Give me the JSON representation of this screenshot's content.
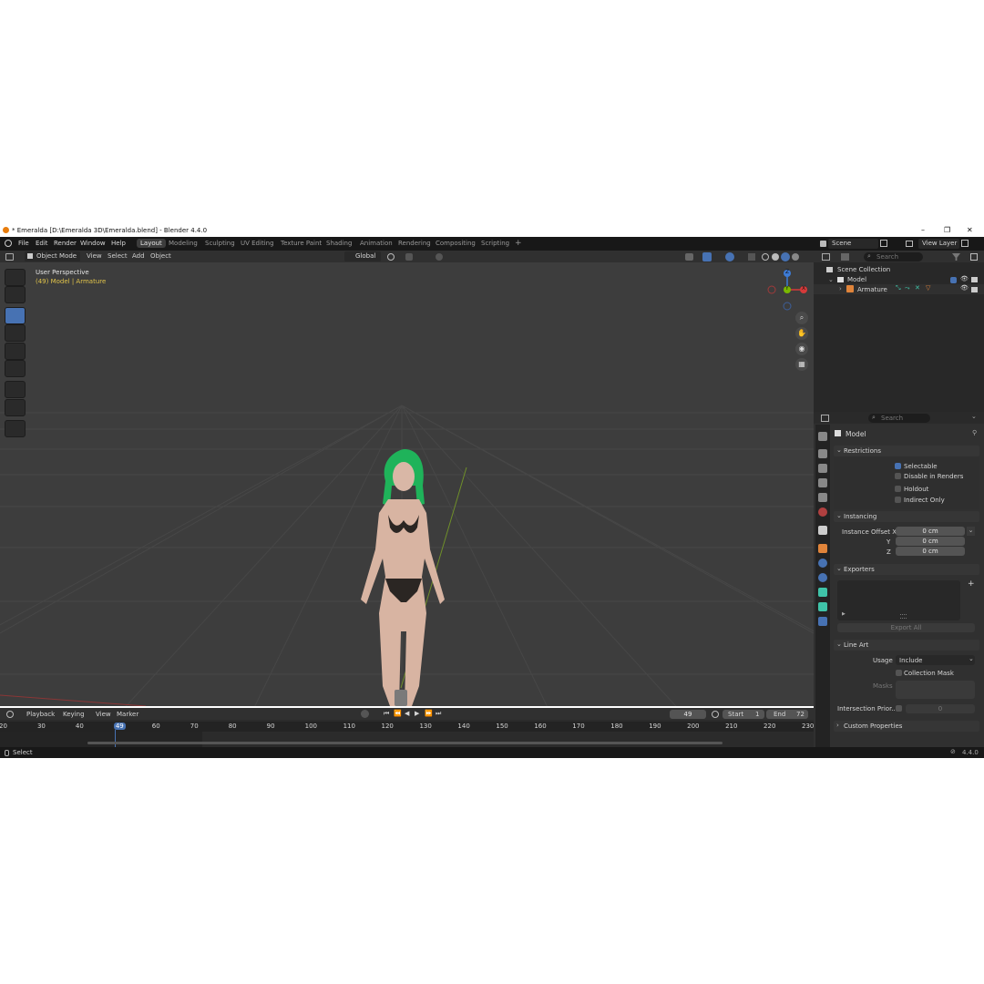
{
  "window": {
    "title": "* Emeralda [D:\\Emeralda 3D\\Emeralda.blend] - Blender 4.4.0",
    "minimize": "–",
    "maximize": "❐",
    "close": "✕"
  },
  "menu": [
    "File",
    "Edit",
    "Render",
    "Window",
    "Help"
  ],
  "workspaces": [
    "Layout",
    "Modeling",
    "Sculpting",
    "UV Editing",
    "Texture Paint",
    "Shading",
    "Animation",
    "Rendering",
    "Compositing",
    "Scripting"
  ],
  "workspace_add": "+",
  "topbar": {
    "scene_label": "Scene",
    "view_layer_label": "View Layer"
  },
  "viewport": {
    "mode": "Object Mode",
    "menus": [
      "View",
      "Select",
      "Add",
      "Object"
    ],
    "orientation": "Global",
    "perspective_label": "User Perspective",
    "context_label": "(49) Model | Armature",
    "gizmo": {
      "z": "Z",
      "y": "Y",
      "x": "X"
    }
  },
  "outliner": {
    "search_placeholder": "Search",
    "scene_collection": "Scene Collection",
    "collection": "Model",
    "child": "Armature"
  },
  "properties": {
    "search_placeholder": "Search",
    "object_name": "Model",
    "restrictions": {
      "title": "Restrictions",
      "selectable": "Selectable",
      "selectable_checked": true,
      "disable_in_renders": "Disable in Renders",
      "holdout": "Holdout",
      "indirect_only": "Indirect Only"
    },
    "instancing": {
      "title": "Instancing",
      "offset_x_label": "Instance Offset X",
      "offset_x": "0 cm",
      "y_label": "Y",
      "y": "0 cm",
      "z_label": "Z",
      "z": "0 cm"
    },
    "exporters": {
      "title": "Exporters",
      "export_all": "Export All",
      "add": "+"
    },
    "line_art": {
      "title": "Line Art",
      "usage_label": "Usage",
      "usage_value": "Include",
      "collection_mask": "Collection Mask",
      "masks_label": "Masks",
      "intersection_label": "Intersection Prior...",
      "intersection_value": "0"
    },
    "custom_properties": "Custom Properties"
  },
  "timeline": {
    "menus": [
      "Playback",
      "Keying",
      "View",
      "Marker"
    ],
    "current_frame": "49",
    "start_label": "Start",
    "start": "1",
    "end_label": "End",
    "end": "72",
    "ruler": [
      "20",
      "30",
      "40",
      "49",
      "60",
      "70",
      "80",
      "90",
      "100",
      "110",
      "120",
      "130",
      "140",
      "150",
      "160",
      "170",
      "180",
      "190",
      "200",
      "210",
      "220",
      "230"
    ]
  },
  "status": {
    "left": "Select",
    "version": "4.4.0"
  },
  "colors": {
    "accent": "#4772b3",
    "viewport_bg": "#3d3d3d",
    "panel_bg": "#303030",
    "hair": "#1fb35a",
    "x_axis": "#d63a3a",
    "y_axis": "#7ab800",
    "z_axis": "#3d7bd6",
    "context_text": "#e0c34a"
  }
}
